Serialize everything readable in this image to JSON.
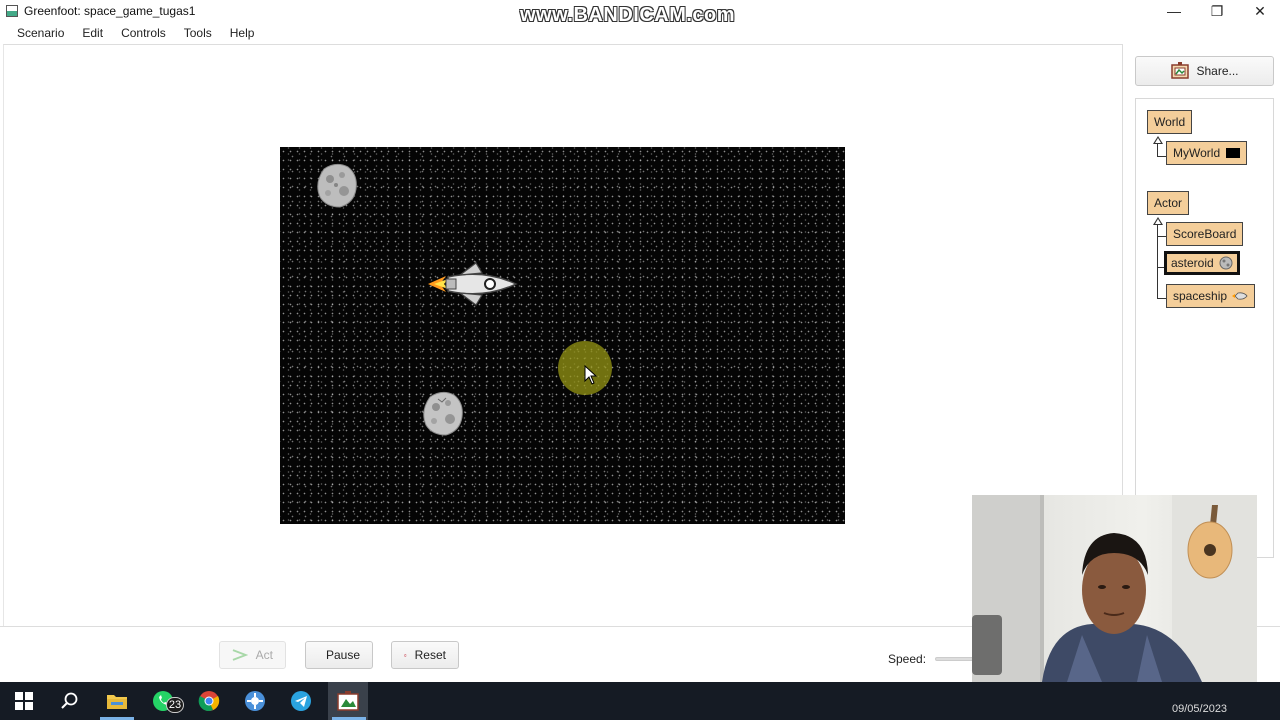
{
  "window": {
    "title": "Greenfoot: space_game_tugas1",
    "watermark": "www.BANDICAM.com",
    "controls": {
      "minimize": "—",
      "restore": "❐",
      "close": "✕"
    }
  },
  "menu": {
    "items": [
      "Scenario",
      "Edit",
      "Controls",
      "Tools",
      "Help"
    ]
  },
  "world": {
    "background": "starfield",
    "actors": [
      "asteroid",
      "asteroid",
      "spaceship"
    ]
  },
  "right_panel": {
    "share_label": "Share...",
    "classes": {
      "world_root": "World",
      "world_sub": "MyWorld",
      "actor_root": "Actor",
      "actor_subs": [
        "ScoreBoard",
        "asteroid",
        "spaceship"
      ],
      "selected": "asteroid"
    }
  },
  "controls": {
    "act_label": "Act",
    "pause_label": "Pause",
    "reset_label": "Reset",
    "speed_label": "Speed:"
  },
  "taskbar": {
    "badge_count": "23",
    "date": "09/05/2023",
    "icons": [
      "windows-start-icon",
      "search-icon",
      "file-explorer-icon",
      "whatsapp-icon",
      "chrome-icon",
      "settings-icon",
      "telegram-icon",
      "greenfoot-icon"
    ]
  },
  "colors": {
    "class_box": "#f4ce9a",
    "taskbar": "#151b24",
    "world_bg": "#050505"
  }
}
